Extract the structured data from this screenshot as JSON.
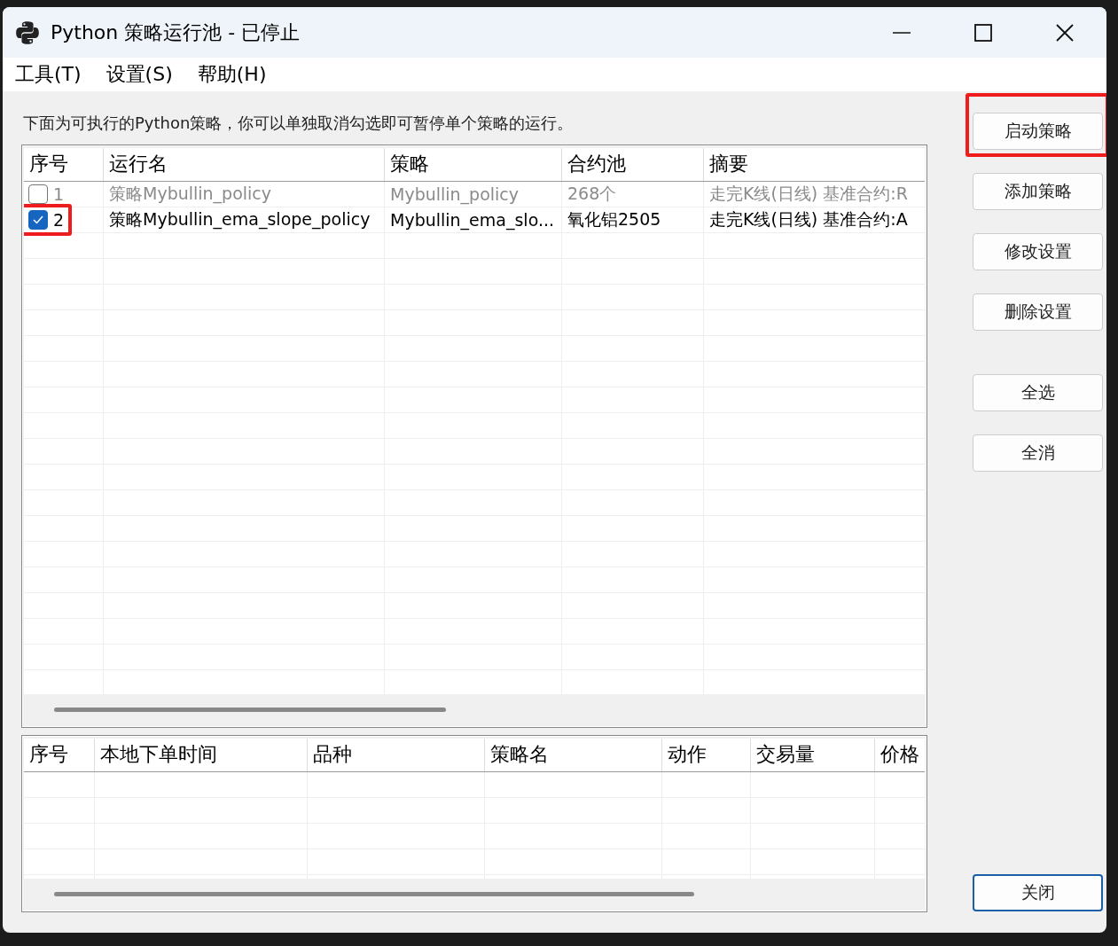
{
  "window": {
    "title": "Python 策略运行池 - 已停止"
  },
  "menu": [
    {
      "label": "工具(T)"
    },
    {
      "label": "设置(S)"
    },
    {
      "label": "帮助(H)"
    }
  ],
  "description": "下面为可执行的Python策略，你可以单独取消勾选即可暂停单个策略的运行。",
  "strategy_table": {
    "columns": [
      "序号",
      "运行名",
      "策略",
      "合约池",
      "摘要"
    ],
    "rows": [
      {
        "index": "1",
        "checked": false,
        "highlighted": false,
        "run_name": "策略Mybullin_policy",
        "strategy": "Mybullin_policy",
        "pool": "268个",
        "summary": "走完K线(日线) 基准合约:R"
      },
      {
        "index": "2",
        "checked": true,
        "highlighted": true,
        "run_name": "策略Mybullin_ema_slope_policy",
        "strategy": "Mybullin_ema_slo...",
        "pool": "氧化铝2505",
        "summary": "走完K线(日线) 基准合约:A"
      }
    ]
  },
  "order_table": {
    "columns": [
      "序号",
      "本地下单时间",
      "品种",
      "策略名",
      "动作",
      "交易量",
      "价格"
    ]
  },
  "button_groups": [
    {
      "buttons": [
        {
          "label": "启动策略",
          "highlighted": true,
          "default": false
        },
        {
          "label": "添加策略",
          "highlighted": false,
          "default": false
        },
        {
          "label": "修改设置",
          "highlighted": false,
          "default": false
        },
        {
          "label": "删除设置",
          "highlighted": false,
          "default": false
        }
      ]
    },
    {
      "buttons": [
        {
          "label": "全选",
          "highlighted": false,
          "default": false
        },
        {
          "label": "全消",
          "highlighted": false,
          "default": false
        }
      ]
    },
    {
      "buttons": [
        {
          "label": "关闭",
          "highlighted": false,
          "default": true
        }
      ]
    }
  ]
}
